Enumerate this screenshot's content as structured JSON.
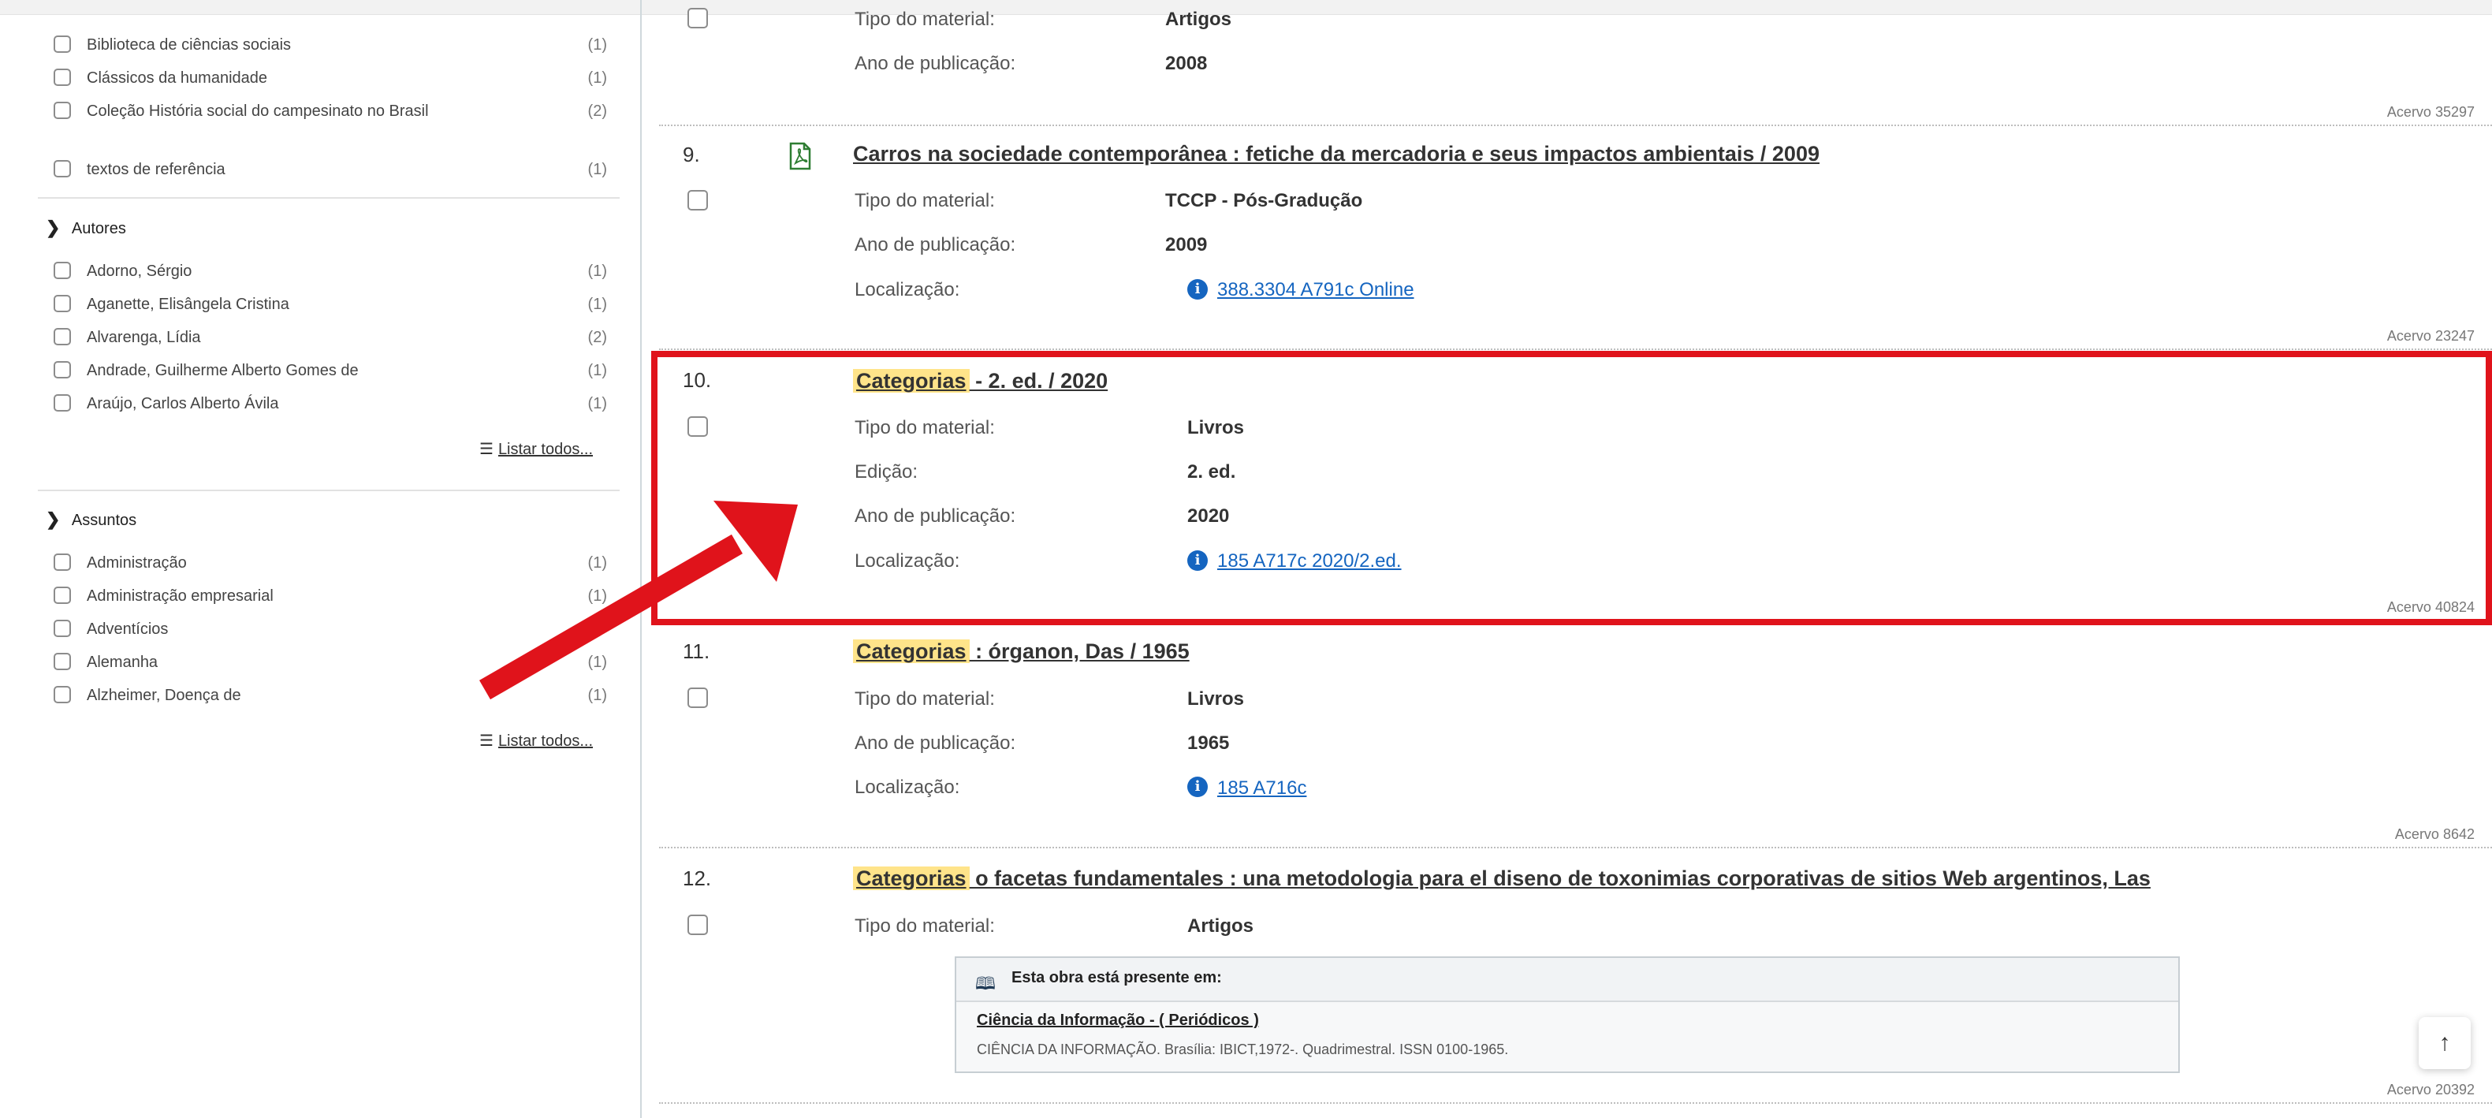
{
  "sidebar": {
    "collection_items": [
      {
        "label": "Biblioteca de ciências sociais",
        "count": "(1)"
      },
      {
        "label": "Clássicos da humanidade",
        "count": "(1)"
      },
      {
        "label": "Coleção História social do campesinato no Brasil",
        "count": "(2)"
      },
      {
        "label": "textos de referência",
        "count": "(1)"
      }
    ],
    "authors": {
      "title": "Autores",
      "items": [
        {
          "label": "Adorno, Sérgio",
          "count": "(1)"
        },
        {
          "label": "Aganette, Elisângela Cristina",
          "count": "(1)"
        },
        {
          "label": "Alvarenga, Lídia",
          "count": "(2)"
        },
        {
          "label": "Andrade, Guilherme Alberto Gomes de",
          "count": "(1)"
        },
        {
          "label": "Araújo, Carlos Alberto Ávila",
          "count": "(1)"
        }
      ],
      "list_all": "Listar todos..."
    },
    "subjects": {
      "title": "Assuntos",
      "items": [
        {
          "label": "Administração",
          "count": "(1)"
        },
        {
          "label": "Administração empresarial",
          "count": "(1)"
        },
        {
          "label": "Adventícios",
          "count": ""
        },
        {
          "label": "Alemanha",
          "count": "(1)"
        },
        {
          "label": "Alzheimer, Doença de",
          "count": "(1)"
        }
      ],
      "list_all": "Listar todos..."
    }
  },
  "results": {
    "r8": {
      "fields": [
        {
          "label": "Tipo do material:",
          "value": "Artigos"
        },
        {
          "label": "Ano de publicação:",
          "value": "2008"
        }
      ],
      "acervo": "Acervo 35297"
    },
    "r9": {
      "number": "9.",
      "title": "Carros na sociedade contemporânea : fetiche da mercadoria e seus impactos ambientais / 2009",
      "fields": [
        {
          "label": "Tipo do material:",
          "value": "TCCP - Pós-Gradução"
        },
        {
          "label": "Ano de publicação:",
          "value": "2009"
        },
        {
          "label": "Localização:",
          "link": "388.3304 A791c Online"
        }
      ],
      "acervo": "Acervo 23247"
    },
    "r10": {
      "number": "10.",
      "title_highlight": "Categorias",
      "title_rest": " - 2. ed. / 2020",
      "fields": [
        {
          "label": "Tipo do material:",
          "value": "Livros"
        },
        {
          "label": "Edição:",
          "value": "2. ed."
        },
        {
          "label": "Ano de publicação:",
          "value": "2020"
        },
        {
          "label": "Localização:",
          "link": "185 A717c 2020/2.ed."
        }
      ],
      "acervo": "Acervo 40824"
    },
    "r11": {
      "number": "11.",
      "title_highlight": "Categorias",
      "title_rest": " : órganon, Das / 1965",
      "fields": [
        {
          "label": "Tipo do material:",
          "value": "Livros"
        },
        {
          "label": "Ano de publicação:",
          "value": "1965"
        },
        {
          "label": "Localização:",
          "link": "185 A716c"
        }
      ],
      "acervo": "Acervo 8642"
    },
    "r12": {
      "number": "12.",
      "title_highlight": "Categorias",
      "title_rest": " o facetas fundamentales : una metodologia para el diseno de toxonimias corporativas de sitios Web argentinos, Las",
      "fields": [
        {
          "label": "Tipo do material:",
          "value": "Artigos"
        }
      ],
      "presence": {
        "heading": "Esta obra está presente em:",
        "link": "Ciência da Informação - ( Periódicos )",
        "text": "CIÊNCIA DA INFORMAÇÃO. Brasília: IBICT,1972-. Quadrimestral. ISSN 0100-1965."
      },
      "acervo": "Acervo 20392"
    }
  },
  "icons": {
    "info": "i",
    "book": "book-icon",
    "pdf": "pdf-icon",
    "chevron": "chevron-right-icon",
    "list": "list-icon",
    "up": "arrow-up-icon"
  },
  "colors": {
    "highlight_box": "#e0131b",
    "arrow": "#e0131b",
    "link": "#1565c0",
    "highlight": "#ffe48a",
    "pdf_icon": "#2e7d32"
  }
}
